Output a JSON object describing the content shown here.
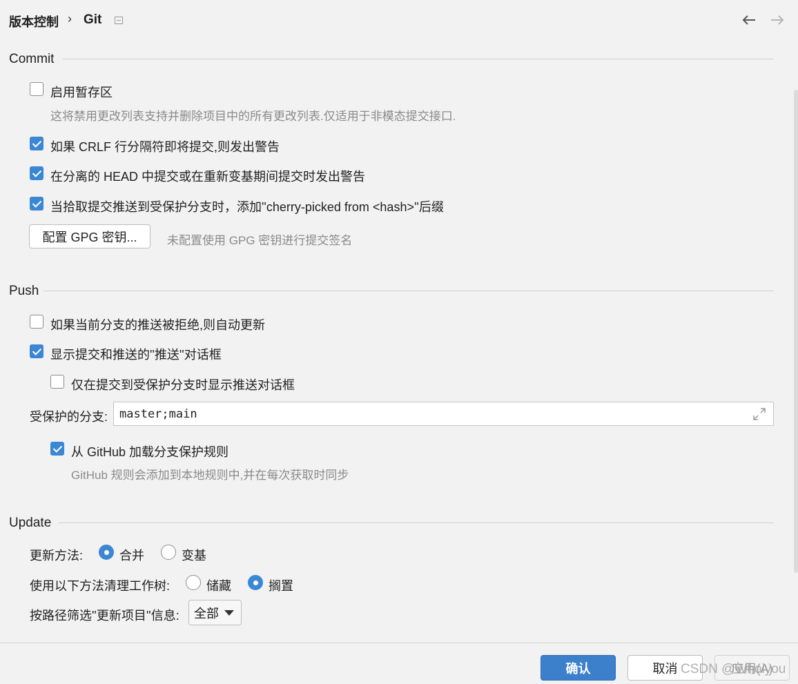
{
  "header": {
    "breadcrumb_root": "版本控制",
    "breadcrumb_separator": "›",
    "breadcrumb_page": "Git",
    "back_icon": "arrow-left-icon",
    "forward_icon": "arrow-right-icon"
  },
  "commit": {
    "title": "Commit",
    "staging": {
      "label": "启用暂存区",
      "checked": false,
      "hint": "这将禁用更改列表支持并删除项目中的所有更改列表.仅适用于非模态提交接口."
    },
    "crlf": {
      "label": "如果 CRLF 行分隔符即将提交,则发出警告",
      "checked": true
    },
    "detached_head": {
      "label": "在分离的 HEAD 中提交或在重新变基期间提交时发出警告",
      "checked": true
    },
    "cherry_pick": {
      "label": "当拾取提交推送到受保护分支时，添加''cherry-picked from <hash>''后缀",
      "checked": true
    },
    "gpg_button": "配置 GPG 密钥...",
    "gpg_status": "未配置使用 GPG 密钥进行提交签名"
  },
  "push": {
    "title": "Push",
    "auto_update": {
      "label": "如果当前分支的推送被拒绝,则自动更新",
      "checked": false
    },
    "show_dialog": {
      "label": "显示提交和推送的''推送''对话框",
      "checked": true
    },
    "protected_only": {
      "label": "仅在提交到受保护分支时显示推送对话框",
      "checked": false
    },
    "protected_branches_label": "受保护的分支:",
    "protected_branches_value": "master;main",
    "github_rules": {
      "label": "从 GitHub 加载分支保护规则",
      "checked": true,
      "hint": "GitHub 规则会添加到本地规则中,并在每次获取时同步"
    }
  },
  "update": {
    "title": "Update",
    "method_label": "更新方法:",
    "method_options": [
      "合并",
      "变基"
    ],
    "method_selected": "合并",
    "clean_label": "使用以下方法清理工作树:",
    "clean_options": [
      "储藏",
      "搁置"
    ],
    "clean_selected": "搁置",
    "filter_label": "按路径筛选''更新项目''信息:",
    "filter_value": "全部"
  },
  "footer": {
    "ok": "确认",
    "cancel": "取消",
    "apply": "应用(A)",
    "watermark": "CSDN @Whoiyou"
  },
  "colors": {
    "accent": "#3c87d4",
    "primary_button": "#3c80cc",
    "background": "#f2f2f2"
  }
}
